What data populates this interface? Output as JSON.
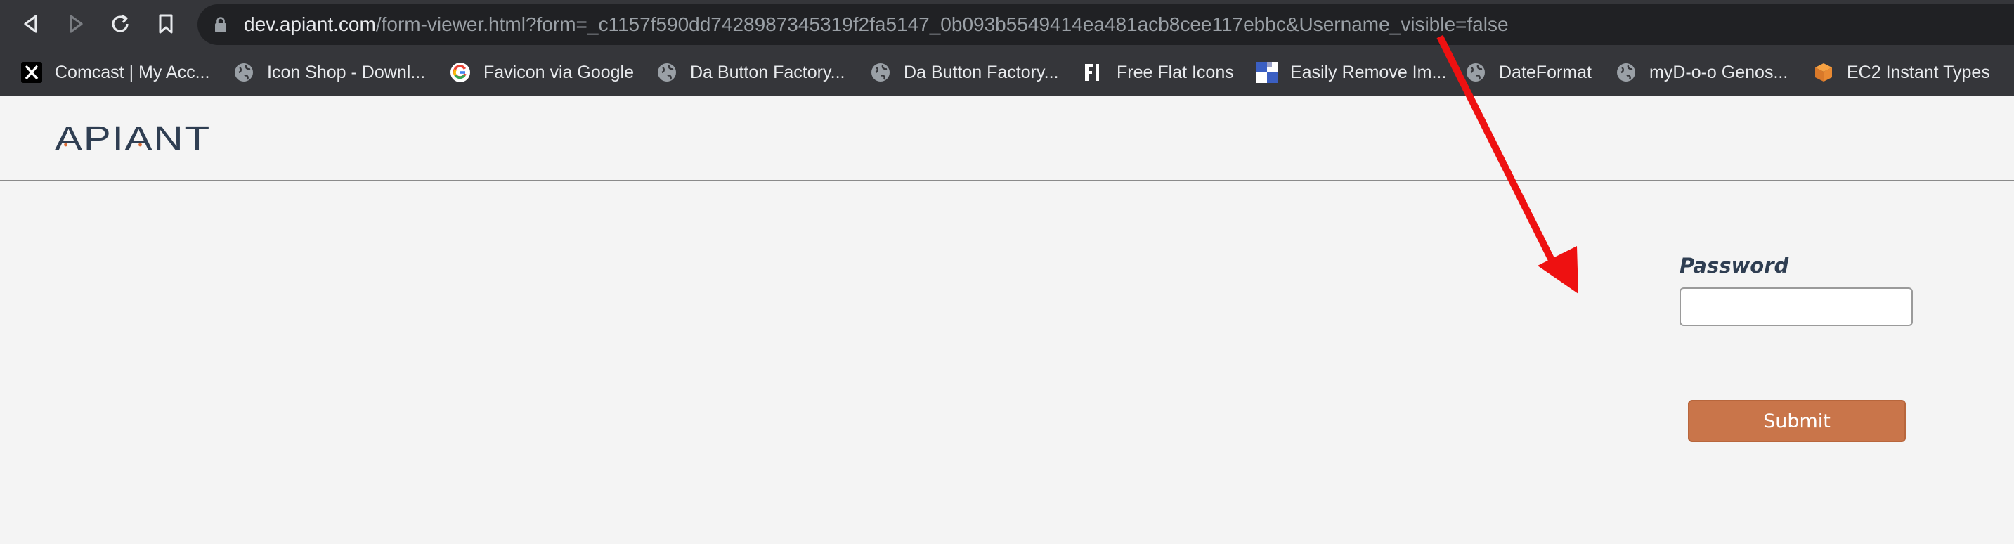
{
  "browser": {
    "url_host": "dev.apiant.com",
    "url_path": "/form-viewer.html?form=_c1157f590dd7428987345319f2fa5147_0b093b5549414ea481acb8cee117ebbc&Username_visible=false",
    "bookmarks": [
      {
        "label": "Comcast | My Acc...",
        "icon": "x-icon"
      },
      {
        "label": "Icon Shop - Downl...",
        "icon": "globe-icon"
      },
      {
        "label": "Favicon via Google",
        "icon": "google-icon"
      },
      {
        "label": "Da Button Factory...",
        "icon": "globe-icon"
      },
      {
        "label": "Da Button Factory...",
        "icon": "globe-icon"
      },
      {
        "label": "Free Flat Icons",
        "icon": "fi-icon"
      },
      {
        "label": "Easily Remove Im...",
        "icon": "checker-icon"
      },
      {
        "label": "DateFormat",
        "icon": "globe-icon"
      },
      {
        "label": "myD-o-o Genos...",
        "icon": "globe-icon"
      },
      {
        "label": "EC2 Instant Types",
        "icon": "cube-icon"
      }
    ]
  },
  "page": {
    "logo_text": "APIANT",
    "form": {
      "password_label": "Password",
      "password_value": "",
      "submit_label": "Submit"
    }
  },
  "colors": {
    "chrome_bg": "#35363a",
    "urlbar_bg": "#202124",
    "page_bg": "#f4f4f4",
    "accent_button": "#c9754a",
    "label_color": "#2f3e52",
    "annotation_arrow": "#ee1111"
  }
}
